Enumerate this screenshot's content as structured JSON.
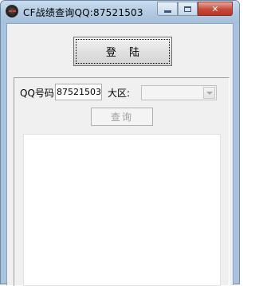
{
  "window": {
    "title": "CF战绩查询QQ:87521503",
    "close_label": "✕"
  },
  "main": {
    "login_button": "登 陆",
    "qq_label": "QQ号码:",
    "qq_value": "87521503",
    "region_label": "大区:",
    "region_value": "",
    "query_button": "查询"
  },
  "colors": {
    "titlebar": "#b3cbe3",
    "close_button": "#c9483a",
    "client_background": "#f0f0f0"
  }
}
